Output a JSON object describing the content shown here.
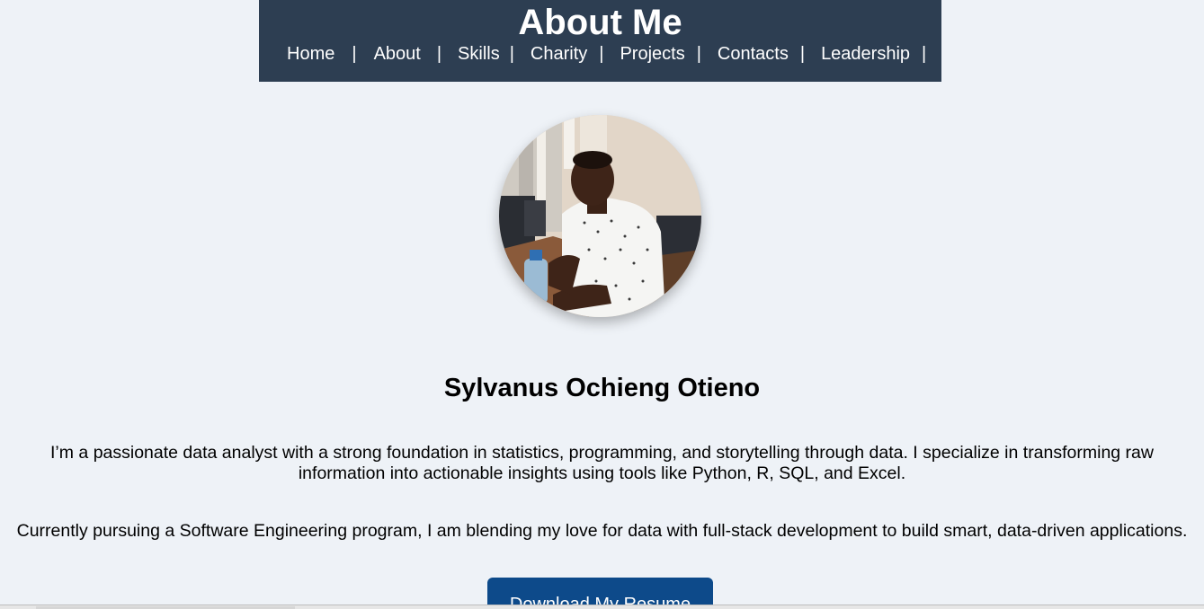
{
  "header": {
    "title": "About Me",
    "bg_color": "#2d3e52",
    "nav": [
      {
        "label": "Home"
      },
      {
        "label": "About"
      },
      {
        "label": "Skills"
      },
      {
        "label": "Charity"
      },
      {
        "label": "Projects"
      },
      {
        "label": "Contacts"
      },
      {
        "label": "Leadership"
      }
    ],
    "separator": "|"
  },
  "profile": {
    "name": "Sylvanus Ochieng Otieno",
    "bio_1": "I’m a passionate data analyst with a strong foundation in statistics, programming, and storytelling through data. I specialize in transforming raw information into actionable insights using tools like Python, R, SQL, and Excel.",
    "bio_2": "Currently pursuing a Software Engineering program, I am blending my love for data with full-stack development to build smart, data-driven applications."
  },
  "resume_button": {
    "label": "Download My Resume",
    "color": "#0d4a8a"
  },
  "colors": {
    "page_bg": "#eef2f7",
    "text": "#000000"
  }
}
